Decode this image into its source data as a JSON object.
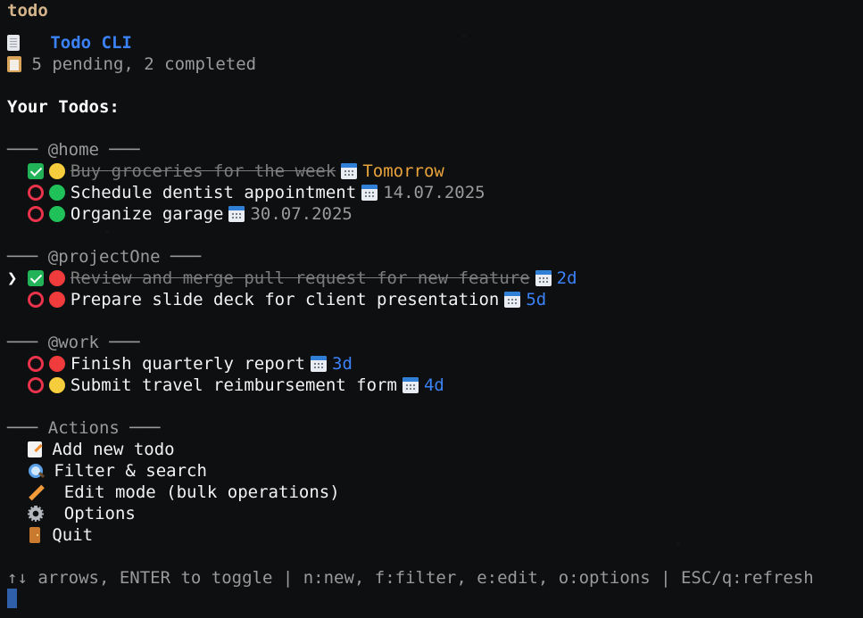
{
  "window": {
    "title": "todo"
  },
  "header": {
    "app_title": "Todo CLI",
    "summary": "5 pending, 2 completed",
    "doc_icon": "document-icon",
    "summary_icon": "clipboard-icon"
  },
  "heading": "Your Todos:",
  "groups": [
    {
      "header": "─── @home ───",
      "items": [
        {
          "done": true,
          "priority": "yellow",
          "text": "Buy groceries for the week",
          "due": "Tomorrow",
          "due_style": "orange"
        },
        {
          "done": false,
          "priority": "green",
          "text": "Schedule dentist appointment",
          "due": "14.07.2025",
          "due_style": "gray"
        },
        {
          "done": false,
          "priority": "green",
          "text": "Organize garage",
          "due": "30.07.2025",
          "due_style": "gray"
        }
      ]
    },
    {
      "header": "─── @projectOne ───",
      "items": [
        {
          "done": true,
          "priority": "red",
          "text": "Review and merge pull request for new feature",
          "due": "2d",
          "due_style": "blue",
          "selected": true,
          "cursor": "❯"
        },
        {
          "done": false,
          "priority": "red",
          "text": "Prepare slide deck for client presentation",
          "due": "5d",
          "due_style": "blue"
        }
      ]
    },
    {
      "header": "─── @work ───",
      "items": [
        {
          "done": false,
          "priority": "red",
          "text": "Finish quarterly report",
          "due": "3d",
          "due_style": "blue"
        },
        {
          "done": false,
          "priority": "yellow",
          "text": "Submit travel reimbursement form",
          "due": "4d",
          "due_style": "blue"
        }
      ]
    }
  ],
  "actions": {
    "header": "─── Actions ───",
    "items": [
      {
        "icon": "memo-icon",
        "label": "Add new todo"
      },
      {
        "icon": "magnifier-icon",
        "label": "Filter & search"
      },
      {
        "icon": "pencil-icon",
        "label": " Edit mode (bulk operations)"
      },
      {
        "icon": "gear-icon",
        "label": " Options"
      },
      {
        "icon": "door-icon",
        "label": "Quit"
      }
    ]
  },
  "footer": {
    "help": "↑↓ arrows, ENTER to toggle | n:new, f:filter, e:edit, o:options | ESC/q:refresh"
  },
  "colors": {
    "accent_blue": "#3b82f6",
    "due_orange": "#e8a33a",
    "check_green": "#22b358",
    "ring_red": "#e8334a",
    "priority_yellow": "#f6cd3d",
    "priority_green": "#21c15a",
    "priority_red": "#ef3b3b"
  }
}
